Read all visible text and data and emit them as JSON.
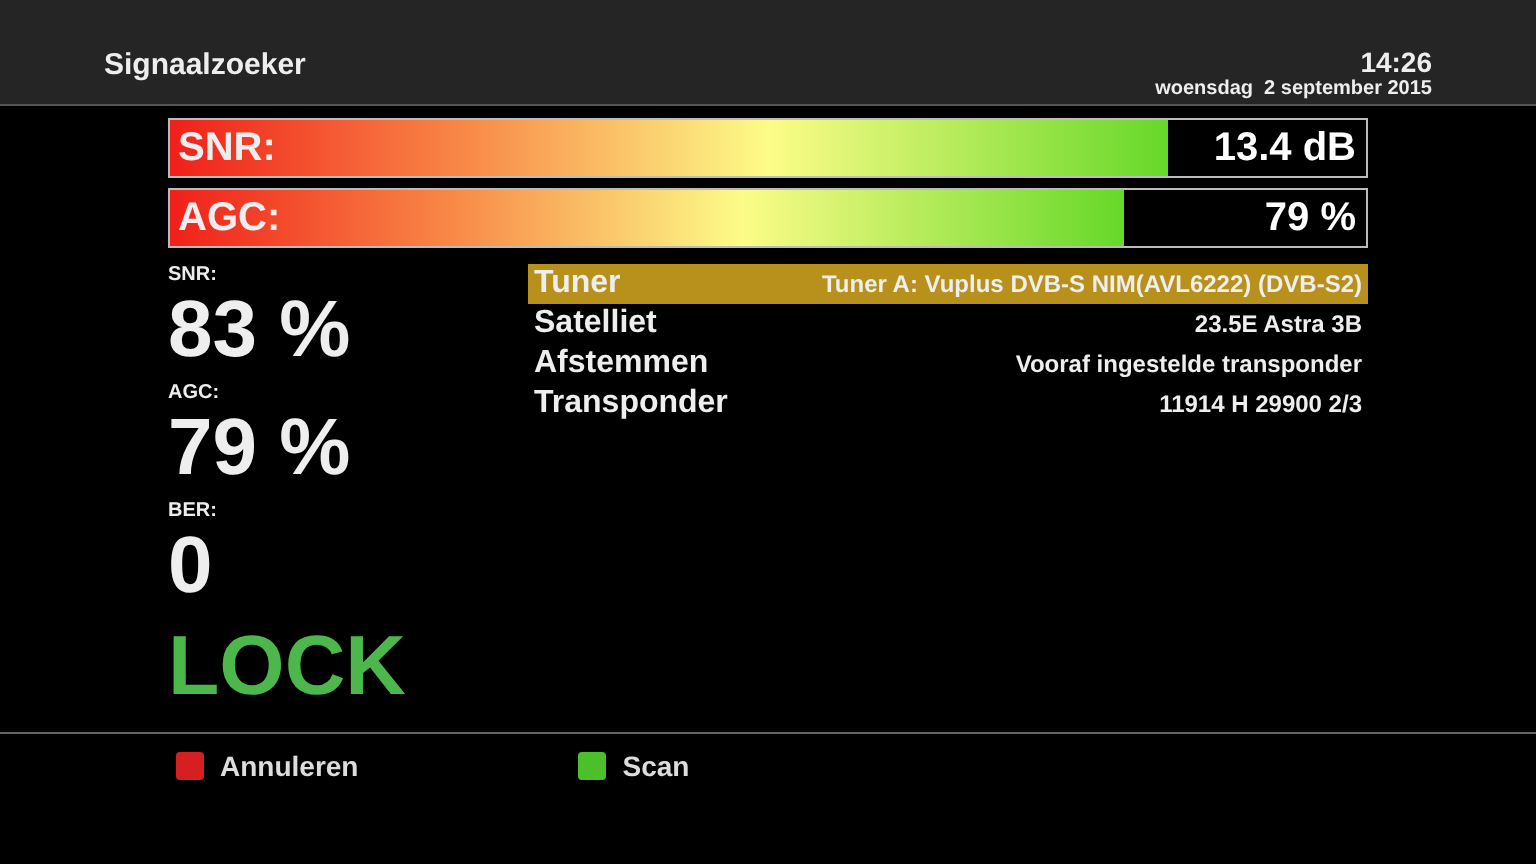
{
  "window": {
    "title": "Signaalzoeker",
    "time": "14:26",
    "date": "woensdag  2 september 2015"
  },
  "meters": [
    {
      "label": "SNR:",
      "level": 0.835,
      "reading": "13.4 dB"
    },
    {
      "label": "AGC:",
      "level": 0.797,
      "reading": "79 %"
    }
  ],
  "stats": [
    {
      "label": "SNR:",
      "value": "83 %"
    },
    {
      "label": "AGC:",
      "value": "79 %"
    },
    {
      "label": "BER:",
      "value": "0"
    }
  ],
  "lock_status": "LOCK",
  "info": [
    {
      "label": "Tuner",
      "value": "Tuner A: Vuplus DVB-S NIM(AVL6222) (DVB-S2)",
      "selected": true
    },
    {
      "label": "Satelliet",
      "value": "23.5E Astra 3B",
      "selected": false
    },
    {
      "label": "Afstemmen",
      "value": "Vooraf ingestelde transponder",
      "selected": false
    },
    {
      "label": "Transponder",
      "value": "11914 H 29900 2/3",
      "selected": false
    }
  ],
  "buttons": [
    {
      "label": "Annuleren",
      "color": "#d42020"
    },
    {
      "label": "Scan",
      "color": "#4cc02a"
    }
  ]
}
